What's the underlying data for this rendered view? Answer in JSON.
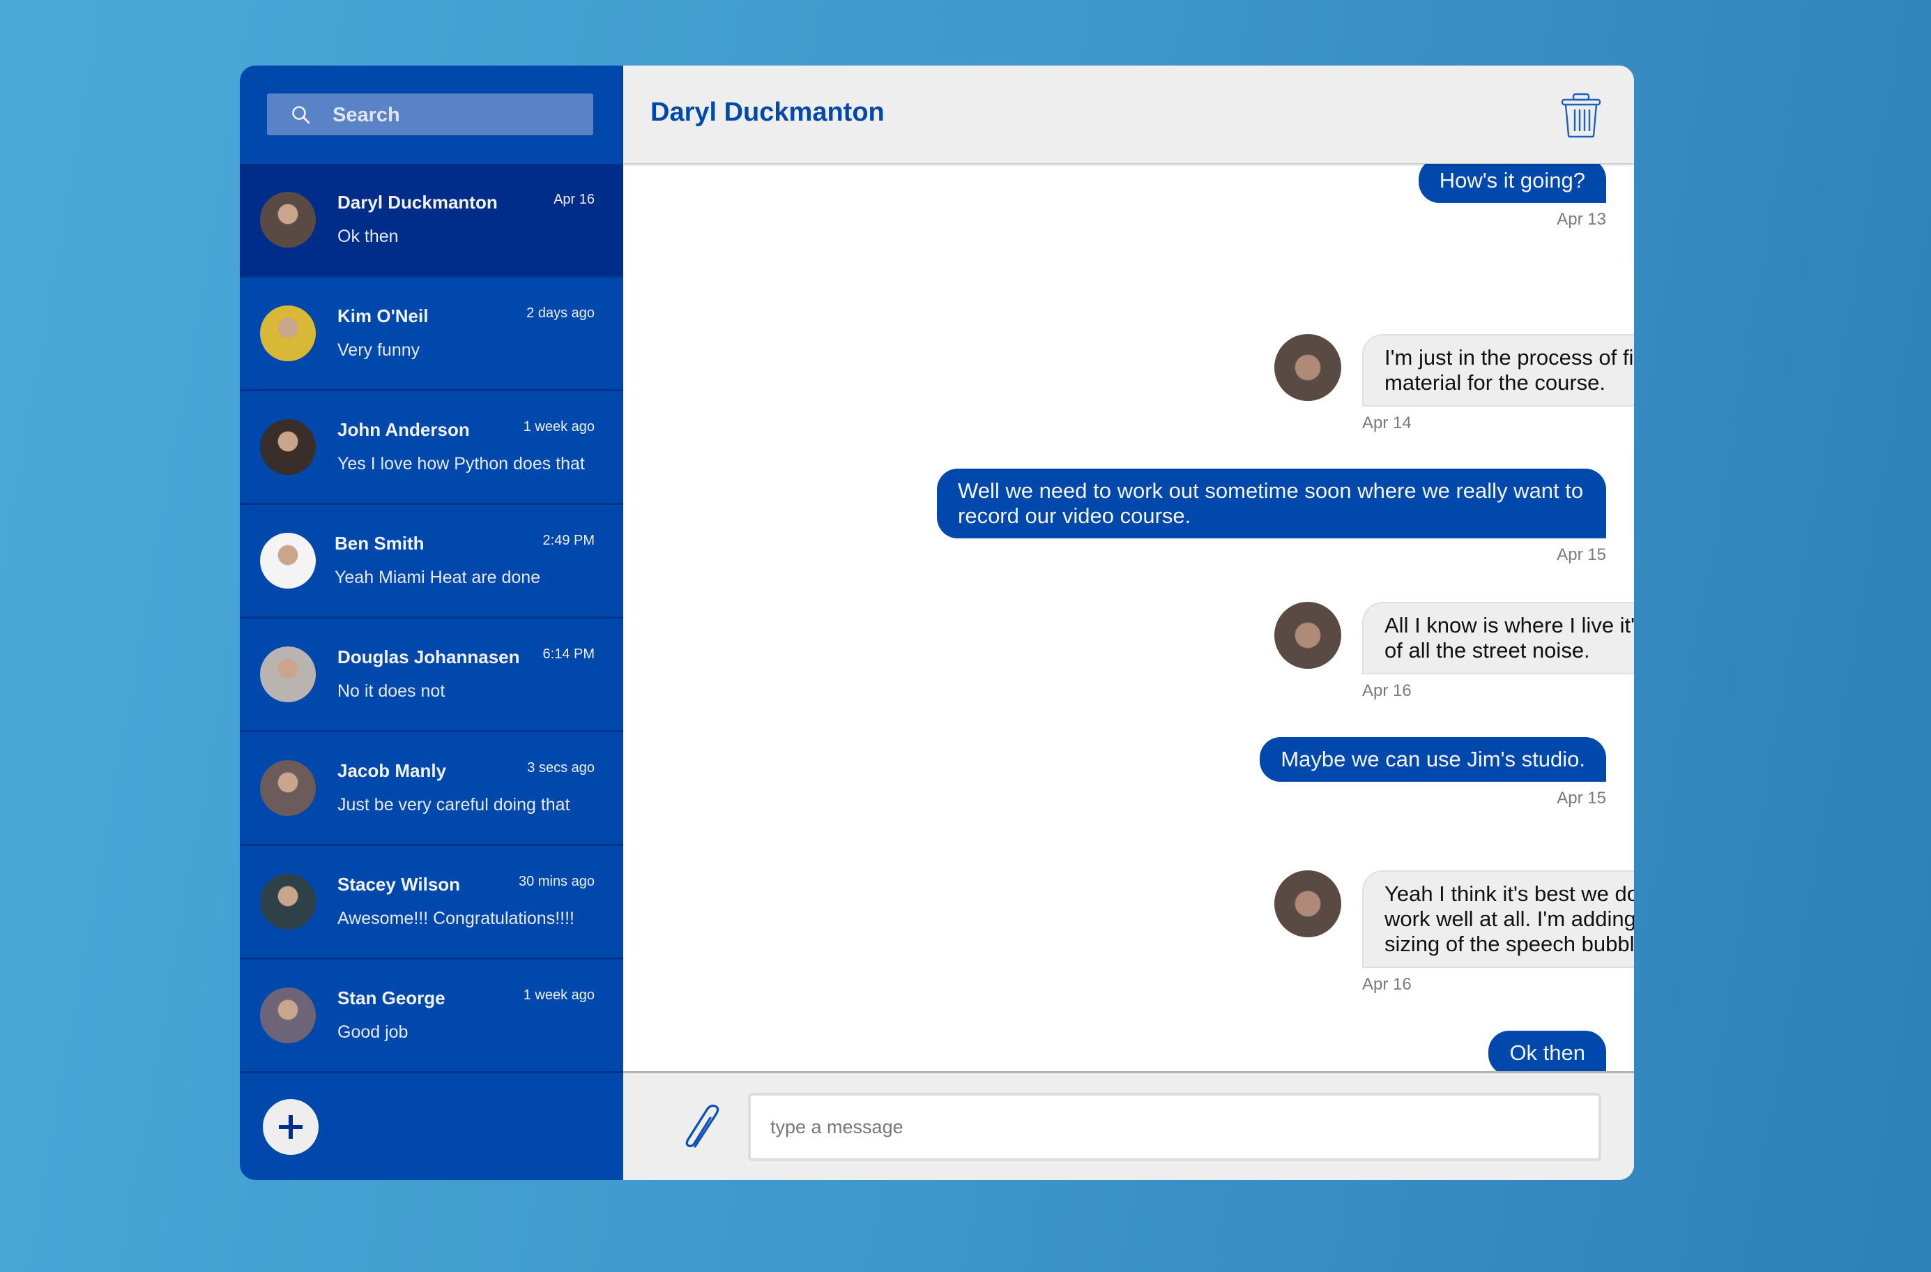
{
  "colors": {
    "brand": "#0048ab",
    "sidebar_active": "#002d8a",
    "received_bubble": "#eeeeee",
    "sent_bubble": "#0048ab"
  },
  "sidebar": {
    "search": {
      "placeholder": "Search",
      "value": "",
      "icon": "search-icon"
    },
    "contacts": [
      {
        "name": "Daryl Duckmanton",
        "time": "Apr 16",
        "preview": "Ok then",
        "active": true,
        "avatar_color": "#5a4a44"
      },
      {
        "name": "Kim O'Neil",
        "time": "2 days ago",
        "preview": "Very funny",
        "active": false,
        "avatar_color": "#d9b838"
      },
      {
        "name": "John Anderson",
        "time": "1 week ago",
        "preview": "Yes I love how Python does that",
        "active": false,
        "avatar_color": "#3a2e2a"
      },
      {
        "name": "Ben Smith",
        "time": "2:49 PM",
        "preview": "Yeah Miami Heat are done",
        "active": false,
        "avatar_color": "#f4f4f4"
      },
      {
        "name": "Douglas Johannasen",
        "time": "6:14 PM",
        "preview": "No it does not",
        "active": false,
        "avatar_color": "#b9b4b0"
      },
      {
        "name": "Jacob Manly",
        "time": "3 secs ago",
        "preview": "Just be very careful doing that",
        "active": false,
        "avatar_color": "#6d5a5a"
      },
      {
        "name": "Stacey Wilson",
        "time": "30 mins ago",
        "preview": "Awesome!!! Congratulations!!!!",
        "active": false,
        "avatar_color": "#2e4048"
      },
      {
        "name": "Stan George",
        "time": "1 week ago",
        "preview": "Good job",
        "active": false,
        "avatar_color": "#6e6478"
      }
    ],
    "add_button_icon": "plus-icon"
  },
  "chat": {
    "title": "Daryl Duckmanton",
    "delete_icon": "trash-icon",
    "messages": [
      {
        "direction": "sent",
        "text": "How's it going?",
        "time": "Apr 13"
      },
      {
        "direction": "received",
        "text": "I'm just in the process of finishing off the last pieces of material for the course.",
        "time": "Apr 14"
      },
      {
        "direction": "sent",
        "text": "Well we need to work out sometime soon where we really want to record our video course.",
        "time": "Apr 15"
      },
      {
        "direction": "received",
        "text": "All I know is where I live it's too hard to record because of all the street noise.",
        "time": "Apr 16"
      },
      {
        "direction": "sent",
        "text": "Maybe we can use Jim's studio.",
        "time": "Apr 15"
      },
      {
        "direction": "received",
        "text": "Yeah I think it's best we do that. Otherwise things won't work well at all. I'm adding more text here to test the sizing of the speech bubble and the wrapping of it too.",
        "time": "Apr 16"
      },
      {
        "direction": "sent",
        "text": "Ok then",
        "time": "Apr 16"
      }
    ],
    "compose": {
      "placeholder": "type a message",
      "value": "",
      "attach_icon": "paperclip-icon"
    }
  }
}
